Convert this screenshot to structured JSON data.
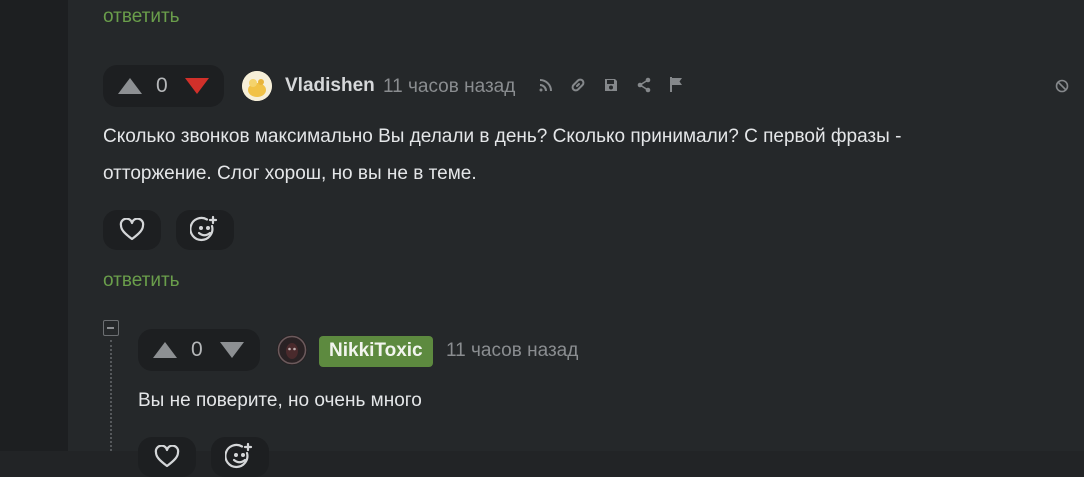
{
  "top_reply_label": "ответить",
  "comment1": {
    "votes": {
      "up_icon": "triangle-up-icon",
      "count": "0",
      "down_icon": "triangle-down-icon",
      "down_color": "#d1302a"
    },
    "author": "Vladishen",
    "time": "11 часов назад",
    "tools": [
      "thread-icon",
      "link-icon",
      "save-icon",
      "share-icon",
      "flag-icon"
    ],
    "hide_icon": "block-icon",
    "text_line1": "Сколько звонков максимально Вы делали в день? Сколько принимали? С первой фразы -",
    "text_line2": "отторжение. Слог хорош, но вы не в теме.",
    "reactions": [
      "heart-icon",
      "add-reaction-icon"
    ],
    "reply_label": "ответить"
  },
  "reply1": {
    "collapse_icon": "minus-square-icon",
    "votes": {
      "count": "0"
    },
    "author": "NikkiToxic",
    "author_badge_color": "#5d8a3f",
    "time": "11 часов назад",
    "text": "Вы не поверите, но очень много",
    "reactions": [
      "heart-icon",
      "add-reaction-icon"
    ]
  }
}
